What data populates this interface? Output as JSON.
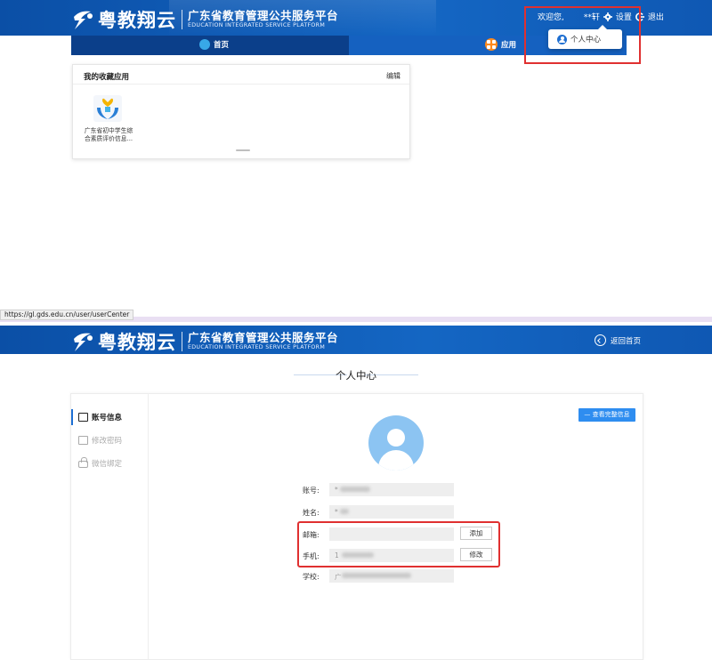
{
  "top": {
    "logo": {
      "name": "粤教翔云",
      "title": "广东省教育管理公共服务平台",
      "subtitle": "EDUCATION INTEGRATED SERVICE PLATFORM"
    },
    "user_menu": {
      "welcome": "欢迎您,",
      "username": "**轩",
      "settings": "设置",
      "logout": "退出"
    },
    "nav": {
      "home": "首页",
      "apps": "应用"
    },
    "dropdown": {
      "personal_center": "个人中心"
    },
    "favorites": {
      "title": "我的收藏应用",
      "edit": "编辑",
      "apps": [
        {
          "label": "广东省初中学生综合素质评价信息..."
        }
      ]
    }
  },
  "status_bar": {
    "url": "https://gl.gds.edu.cn/user/userCenter"
  },
  "bottom": {
    "logo": {
      "name": "粤教翔云",
      "title": "广东省教育管理公共服务平台",
      "subtitle": "EDUCATION INTEGRATED SERVICE PLATFORM"
    },
    "back_home": "返回首页",
    "page_title": "个人中心",
    "sidebar": {
      "items": [
        {
          "label": "账号信息"
        },
        {
          "label": "修改密码"
        },
        {
          "label": "微信绑定"
        }
      ]
    },
    "view_full_info": "查看完整信息",
    "fields": {
      "account": {
        "label": "账号:",
        "value": "*"
      },
      "name": {
        "label": "姓名:",
        "value": "*"
      },
      "email": {
        "label": "邮箱:",
        "value": "",
        "action": "添加"
      },
      "phone": {
        "label": "手机:",
        "value": "1",
        "action": "修改"
      },
      "school": {
        "label": "学校:",
        "value": "广"
      }
    }
  },
  "colors": {
    "brand_blue": "#1466c3",
    "highlight_red": "#e03030",
    "button_blue": "#2e8df0",
    "avatar_blue": "#8cc4f2"
  }
}
